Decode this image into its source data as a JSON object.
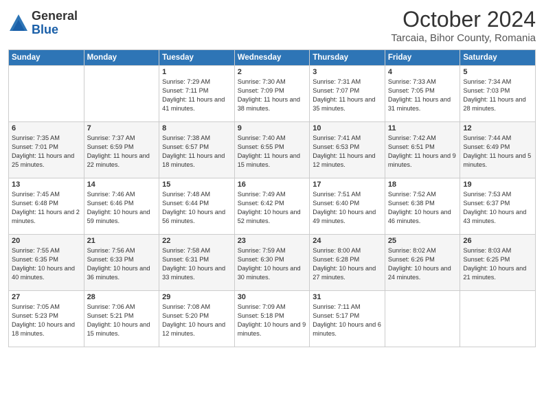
{
  "logo": {
    "general": "General",
    "blue": "Blue"
  },
  "header": {
    "month": "October 2024",
    "location": "Tarcaia, Bihor County, Romania"
  },
  "days_of_week": [
    "Sunday",
    "Monday",
    "Tuesday",
    "Wednesday",
    "Thursday",
    "Friday",
    "Saturday"
  ],
  "weeks": [
    [
      {
        "day": "",
        "info": ""
      },
      {
        "day": "",
        "info": ""
      },
      {
        "day": "1",
        "info": "Sunrise: 7:29 AM\nSunset: 7:11 PM\nDaylight: 11 hours and 41 minutes."
      },
      {
        "day": "2",
        "info": "Sunrise: 7:30 AM\nSunset: 7:09 PM\nDaylight: 11 hours and 38 minutes."
      },
      {
        "day": "3",
        "info": "Sunrise: 7:31 AM\nSunset: 7:07 PM\nDaylight: 11 hours and 35 minutes."
      },
      {
        "day": "4",
        "info": "Sunrise: 7:33 AM\nSunset: 7:05 PM\nDaylight: 11 hours and 31 minutes."
      },
      {
        "day": "5",
        "info": "Sunrise: 7:34 AM\nSunset: 7:03 PM\nDaylight: 11 hours and 28 minutes."
      }
    ],
    [
      {
        "day": "6",
        "info": "Sunrise: 7:35 AM\nSunset: 7:01 PM\nDaylight: 11 hours and 25 minutes."
      },
      {
        "day": "7",
        "info": "Sunrise: 7:37 AM\nSunset: 6:59 PM\nDaylight: 11 hours and 22 minutes."
      },
      {
        "day": "8",
        "info": "Sunrise: 7:38 AM\nSunset: 6:57 PM\nDaylight: 11 hours and 18 minutes."
      },
      {
        "day": "9",
        "info": "Sunrise: 7:40 AM\nSunset: 6:55 PM\nDaylight: 11 hours and 15 minutes."
      },
      {
        "day": "10",
        "info": "Sunrise: 7:41 AM\nSunset: 6:53 PM\nDaylight: 11 hours and 12 minutes."
      },
      {
        "day": "11",
        "info": "Sunrise: 7:42 AM\nSunset: 6:51 PM\nDaylight: 11 hours and 9 minutes."
      },
      {
        "day": "12",
        "info": "Sunrise: 7:44 AM\nSunset: 6:49 PM\nDaylight: 11 hours and 5 minutes."
      }
    ],
    [
      {
        "day": "13",
        "info": "Sunrise: 7:45 AM\nSunset: 6:48 PM\nDaylight: 11 hours and 2 minutes."
      },
      {
        "day": "14",
        "info": "Sunrise: 7:46 AM\nSunset: 6:46 PM\nDaylight: 10 hours and 59 minutes."
      },
      {
        "day": "15",
        "info": "Sunrise: 7:48 AM\nSunset: 6:44 PM\nDaylight: 10 hours and 56 minutes."
      },
      {
        "day": "16",
        "info": "Sunrise: 7:49 AM\nSunset: 6:42 PM\nDaylight: 10 hours and 52 minutes."
      },
      {
        "day": "17",
        "info": "Sunrise: 7:51 AM\nSunset: 6:40 PM\nDaylight: 10 hours and 49 minutes."
      },
      {
        "day": "18",
        "info": "Sunrise: 7:52 AM\nSunset: 6:38 PM\nDaylight: 10 hours and 46 minutes."
      },
      {
        "day": "19",
        "info": "Sunrise: 7:53 AM\nSunset: 6:37 PM\nDaylight: 10 hours and 43 minutes."
      }
    ],
    [
      {
        "day": "20",
        "info": "Sunrise: 7:55 AM\nSunset: 6:35 PM\nDaylight: 10 hours and 40 minutes."
      },
      {
        "day": "21",
        "info": "Sunrise: 7:56 AM\nSunset: 6:33 PM\nDaylight: 10 hours and 36 minutes."
      },
      {
        "day": "22",
        "info": "Sunrise: 7:58 AM\nSunset: 6:31 PM\nDaylight: 10 hours and 33 minutes."
      },
      {
        "day": "23",
        "info": "Sunrise: 7:59 AM\nSunset: 6:30 PM\nDaylight: 10 hours and 30 minutes."
      },
      {
        "day": "24",
        "info": "Sunrise: 8:00 AM\nSunset: 6:28 PM\nDaylight: 10 hours and 27 minutes."
      },
      {
        "day": "25",
        "info": "Sunrise: 8:02 AM\nSunset: 6:26 PM\nDaylight: 10 hours and 24 minutes."
      },
      {
        "day": "26",
        "info": "Sunrise: 8:03 AM\nSunset: 6:25 PM\nDaylight: 10 hours and 21 minutes."
      }
    ],
    [
      {
        "day": "27",
        "info": "Sunrise: 7:05 AM\nSunset: 5:23 PM\nDaylight: 10 hours and 18 minutes."
      },
      {
        "day": "28",
        "info": "Sunrise: 7:06 AM\nSunset: 5:21 PM\nDaylight: 10 hours and 15 minutes."
      },
      {
        "day": "29",
        "info": "Sunrise: 7:08 AM\nSunset: 5:20 PM\nDaylight: 10 hours and 12 minutes."
      },
      {
        "day": "30",
        "info": "Sunrise: 7:09 AM\nSunset: 5:18 PM\nDaylight: 10 hours and 9 minutes."
      },
      {
        "day": "31",
        "info": "Sunrise: 7:11 AM\nSunset: 5:17 PM\nDaylight: 10 hours and 6 minutes."
      },
      {
        "day": "",
        "info": ""
      },
      {
        "day": "",
        "info": ""
      }
    ]
  ]
}
